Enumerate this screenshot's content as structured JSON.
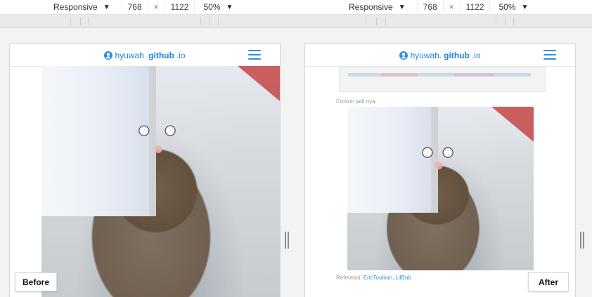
{
  "toolbars": [
    {
      "preset": "Responsive",
      "width": "768",
      "times": "×",
      "height": "1122",
      "zoom": "50%"
    },
    {
      "preset": "Responsive",
      "width": "768",
      "times": "×",
      "height": "1122",
      "zoom": "50%"
    }
  ],
  "site": {
    "logo_prefix": "hyuwah.",
    "logo_bold": "github",
    "logo_suffix": ".io"
  },
  "right_article": {
    "contoh": "Contoh jadi nya:",
    "ref_label": "Referensi:",
    "ref_link_1": "EricToulson",
    "ref_sep": ",",
    "ref_link_2": "LilBub"
  },
  "labels": {
    "before": "Before",
    "after": "After"
  },
  "colors": {
    "accent": "#2d8fe0"
  }
}
